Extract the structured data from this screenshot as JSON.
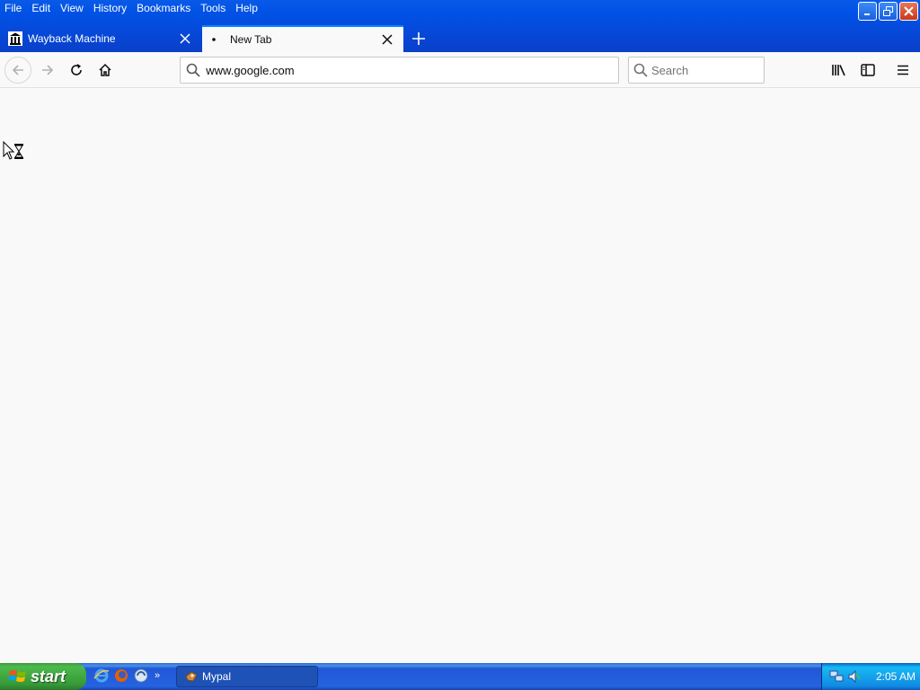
{
  "menu": [
    "File",
    "Edit",
    "View",
    "History",
    "Bookmarks",
    "Tools",
    "Help"
  ],
  "tabs": [
    {
      "title": "Wayback Machine",
      "active": false
    },
    {
      "title": "New Tab",
      "active": true
    }
  ],
  "urlbar": {
    "value": "www.google.com"
  },
  "searchbar": {
    "placeholder": "Search"
  },
  "taskbar": {
    "start_label": "start",
    "task_label": "Mypal",
    "clock": "2:05 AM"
  },
  "colors": {
    "titlebar": "#0052e6",
    "accent": "#0a84ff",
    "start": "#3c9a3c",
    "page_bg": "#f9f9fa"
  }
}
